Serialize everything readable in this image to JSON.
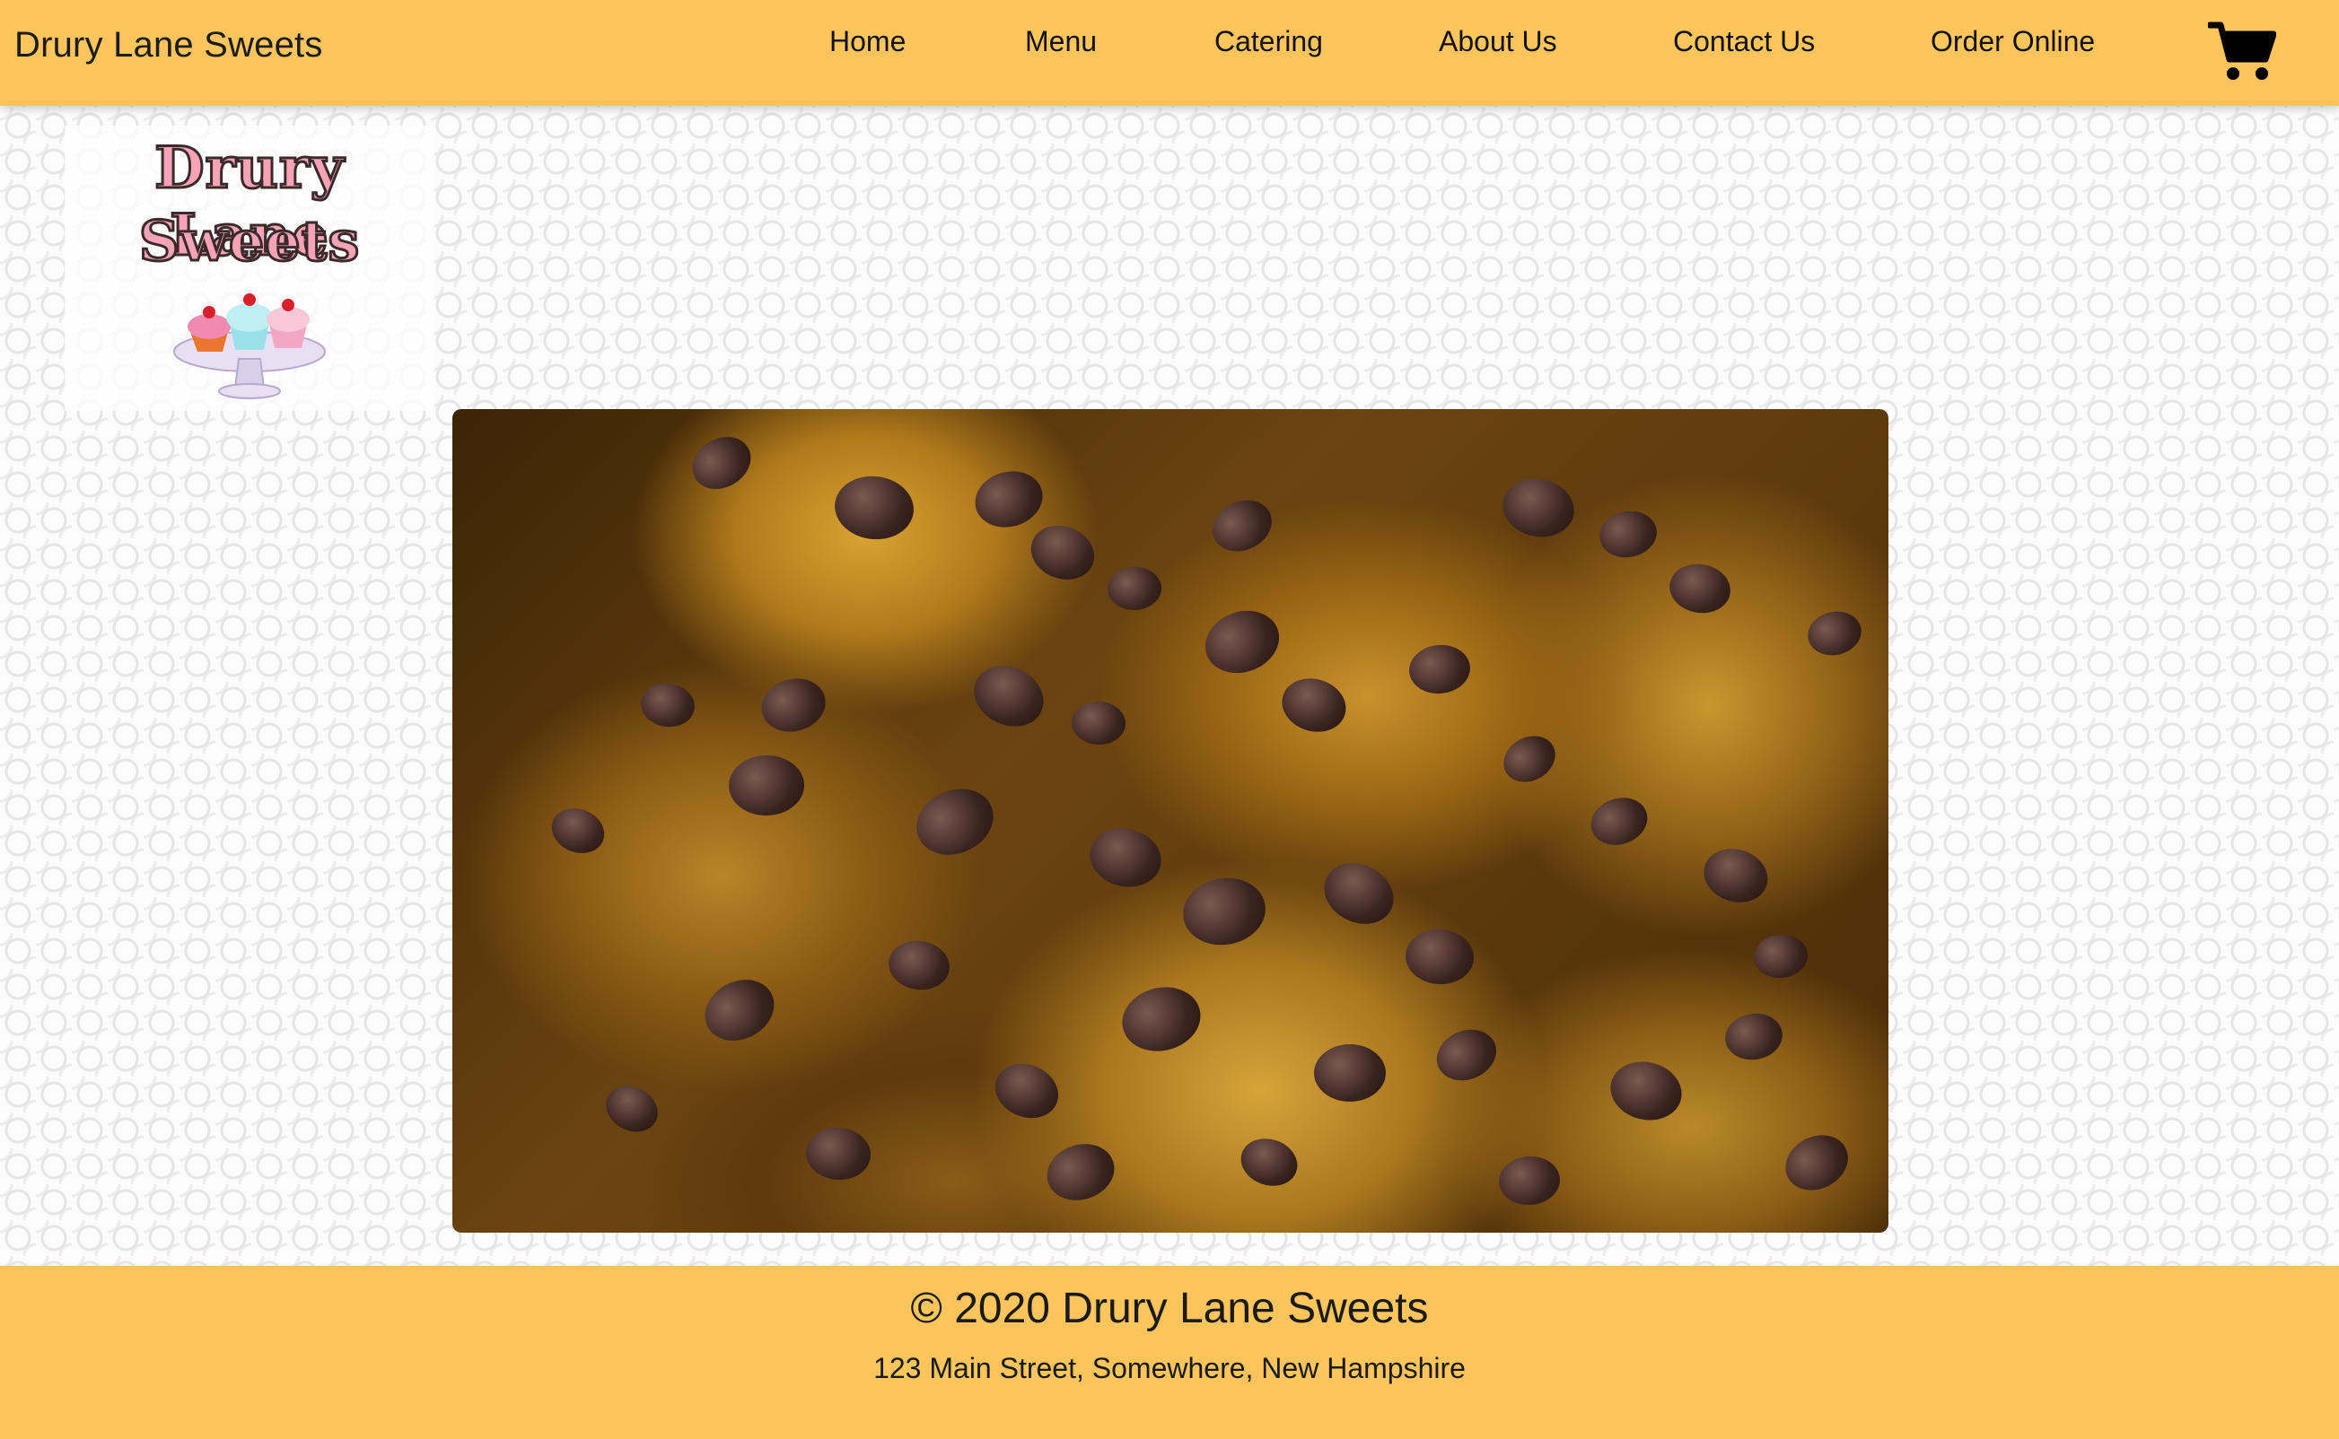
{
  "header": {
    "brand": "Drury Lane Sweets",
    "nav": [
      {
        "label": "Home"
      },
      {
        "label": "Menu"
      },
      {
        "label": "Catering"
      },
      {
        "label": "About Us"
      },
      {
        "label": "Contact Us"
      },
      {
        "label": "Order Online"
      }
    ],
    "cart_icon": "shopping-cart-icon"
  },
  "logo": {
    "line1": "Drury Lane",
    "line2": "Sweets",
    "image": "cupcake-stand-illustration"
  },
  "hero": {
    "image": "chocolate-chip-cookies-photo"
  },
  "footer": {
    "copyright": "© 2020 Drury Lane Sweets",
    "address": "123 Main Street, Somewhere, New Hampshire"
  },
  "colors": {
    "accent": "#ffc55c",
    "text": "#1a1a1a",
    "logo_pink": "#f5a3b5"
  }
}
